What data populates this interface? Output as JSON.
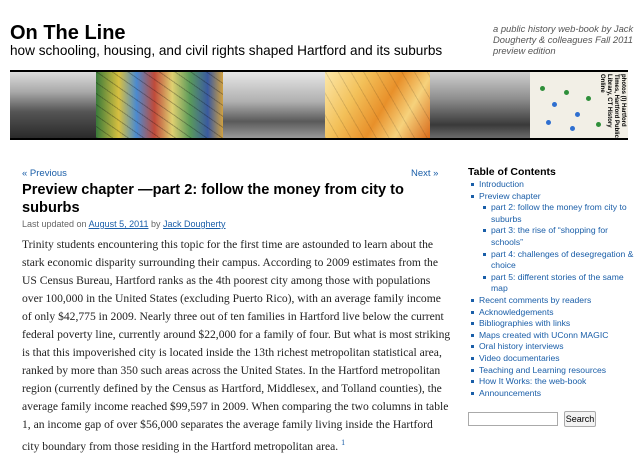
{
  "site": {
    "title": "On The Line",
    "description": "how schooling, housing, and civil rights shaped Hartford and its suburbs",
    "tagline": "a public history web-book by Jack Dougherty & colleagues Fall 2011 preview edition",
    "banner_credit": "photos (l) Hartford Times, Hartford Public Library, CT History Online"
  },
  "post": {
    "prev_label": "« Previous",
    "next_label": "Next »",
    "title": "Preview chapter —part 2: follow the money from city to suburbs",
    "updated_prefix": "Last updated on",
    "date": "August 5, 2011",
    "by": "by",
    "author": "Jack Dougherty",
    "body": "Trinity students encountering this topic for the first time are astounded to learn about the stark economic disparity surrounding their campus. According to 2009 estimates from the US Census Bureau, Hartford ranks as the 4th poorest city among those with populations over 100,000 in the United States (excluding Puerto Rico), with an average family income of only $42,775 in 2009. Nearly three out of ten families in Hartford live below the current federal poverty line, currently around $22,000 for a family of four. But what is most striking is that this impoverished city is located inside the 13th richest metropolitan statistical area, ranked by more than 350 such areas across the United States. In the Hartford metropolitan region (currently defined by the Census as Hartford, Middlesex, and Tolland counties), the average family income reached $99,597 in 2009. When comparing the two columns in table 1, an income gap of over $56,000 separates the average family living inside the Hartford city boundary from those residing in the Hartford metropolitan area.",
    "footnote": "1"
  },
  "sidebar": {
    "toc_heading": "Table of Contents",
    "items": [
      {
        "label": "Introduction"
      },
      {
        "label": "Preview chapter"
      },
      {
        "label": "part 2: follow the money from city to suburbs"
      },
      {
        "label": "part 3: the rise of “shopping for schools”"
      },
      {
        "label": "part 4: challenges of desegregation & choice"
      },
      {
        "label": "part 5: different stories of the same map"
      },
      {
        "label": "Recent comments by readers"
      },
      {
        "label": "Acknowledgements"
      },
      {
        "label": "Bibliographies with links"
      },
      {
        "label": "Maps created with UConn MAGIC"
      },
      {
        "label": "Oral history interviews"
      },
      {
        "label": "Video documentaries"
      },
      {
        "label": "Teaching and Learning resources"
      },
      {
        "label": "How It Works: the web-book"
      },
      {
        "label": "Announcements"
      }
    ],
    "search_value": "",
    "search_button": "Search"
  },
  "colors": {
    "link": "#1a5ea8",
    "meta": "#666666",
    "tagline": "#555555"
  }
}
